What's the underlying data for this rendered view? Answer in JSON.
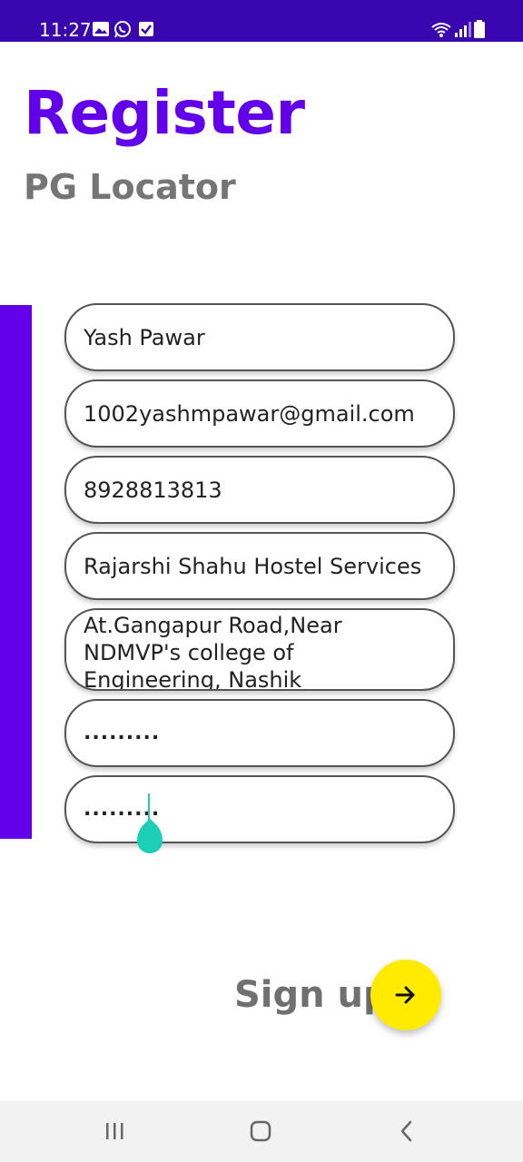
{
  "status_bar": {
    "time": "11:27",
    "icons": [
      "image-icon",
      "whatsapp-icon",
      "checkbox-icon",
      "wifi-icon",
      "signal-icon",
      "battery-icon"
    ]
  },
  "header": {
    "title": "Register",
    "subtitle": "PG Locator"
  },
  "form": {
    "name": "Yash Pawar",
    "email": "1002yashmpawar@gmail.com",
    "phone": "8928813813",
    "hostel_name": "Rajarshi Shahu Hostel Services",
    "address": "At.Gangapur Road,Near\nNDMVP's college of\nEngineering, Nashik",
    "password": ".........",
    "confirm_password": "........."
  },
  "signup": {
    "label": "Sign up",
    "icon": "arrow-right-icon"
  },
  "nav_bar": {
    "icons": [
      "recent-apps-icon",
      "home-icon",
      "back-icon"
    ]
  },
  "colors": {
    "status_bar": "#3a06b0",
    "accent": "#6200ea",
    "fab": "#ffeb00",
    "cursor": "#1ccfb6",
    "subtitle": "#757575"
  }
}
